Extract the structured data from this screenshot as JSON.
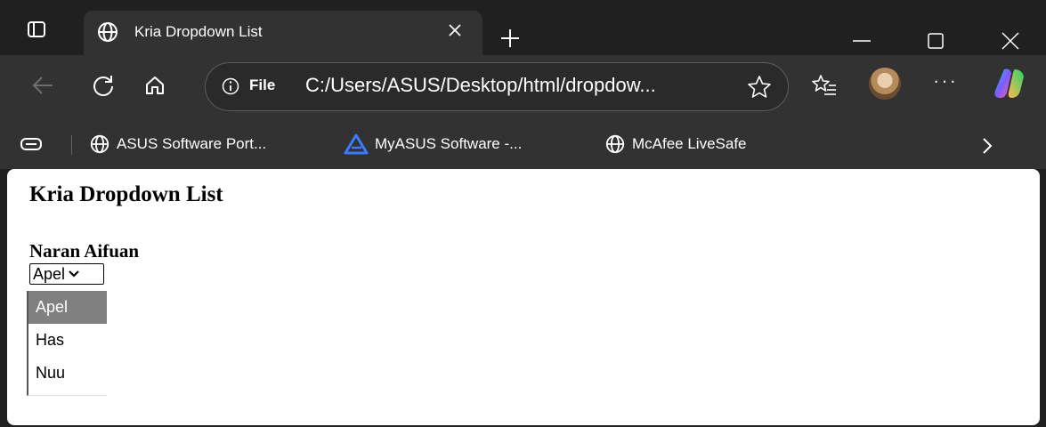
{
  "tab": {
    "title": "Kria Dropdown List"
  },
  "address": {
    "scheme_label": "File",
    "url": "C:/Users/ASUS/Desktop/html/dropdow..."
  },
  "bookmarks": [
    {
      "label": "ASUS Software Port...",
      "icon": "globe-icon"
    },
    {
      "label": "MyASUS Software -...",
      "icon": "myasus-logo-icon"
    },
    {
      "label": "McAfee LiveSafe",
      "icon": "globe-icon"
    }
  ],
  "page": {
    "heading": "Kria Dropdown List",
    "field_label": "Naran Aifuan",
    "select_value": "Apel",
    "options": [
      {
        "label": "Apel",
        "selected": true
      },
      {
        "label": "Has",
        "selected": false
      },
      {
        "label": "Nuu",
        "selected": false
      }
    ]
  },
  "colors": {
    "chrome_dark": "#202020",
    "toolbar": "#323232",
    "page_bg": "#ffffff",
    "option_highlight": "#808080",
    "myasus_blue": "#3b7bff"
  }
}
